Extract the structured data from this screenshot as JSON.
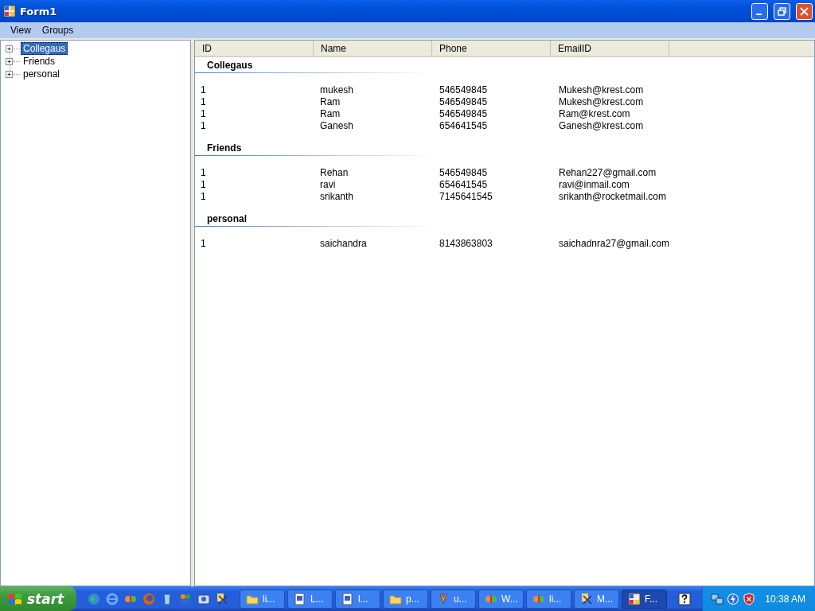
{
  "window": {
    "title": "Form1"
  },
  "menu": [
    {
      "label": "View"
    },
    {
      "label": "Groups"
    }
  ],
  "tree": [
    {
      "label": "Collegaus",
      "selected": true,
      "expanded": false
    },
    {
      "label": "Friends",
      "selected": false,
      "expanded": false
    },
    {
      "label": "personal",
      "selected": false,
      "expanded": false
    }
  ],
  "list": {
    "columns": [
      "ID",
      "Name",
      "Phone",
      "EmailID"
    ],
    "groups": [
      {
        "title": "Collegaus",
        "rows": [
          [
            "1",
            "mukesh",
            "546549845",
            "Mukesh@krest.com"
          ],
          [
            "1",
            "Ram",
            "546549845",
            "Mukesh@krest.com"
          ],
          [
            "1",
            "Ram",
            "546549845",
            "Ram@krest.com"
          ],
          [
            "1",
            "Ganesh",
            "654641545",
            "Ganesh@krest.com"
          ]
        ]
      },
      {
        "title": "Friends",
        "rows": [
          [
            "1",
            "Rehan",
            "546549845",
            "Rehan227@gmail.com"
          ],
          [
            "1",
            "ravi",
            "654641545",
            "ravi@inmail.com"
          ],
          [
            "1",
            "srikanth",
            "7145641545",
            "srikanth@rocketmail.com"
          ]
        ]
      },
      {
        "title": "personal",
        "rows": [
          [
            "1",
            "saichandra",
            "8143863803",
            "saichadnra27@gmail.com"
          ]
        ]
      }
    ]
  },
  "taskbar": {
    "start": "start",
    "buttons": [
      {
        "label": "li...",
        "selected": false
      },
      {
        "label": "L...",
        "selected": false
      },
      {
        "label": "l...",
        "selected": false
      },
      {
        "label": "p...",
        "selected": false
      },
      {
        "label": "u...",
        "selected": false
      },
      {
        "label": "W...",
        "selected": false
      },
      {
        "label": "li...",
        "selected": false
      },
      {
        "label": "M...",
        "selected": false
      },
      {
        "label": "F...",
        "selected": true
      }
    ],
    "clock": "10:38 AM"
  }
}
